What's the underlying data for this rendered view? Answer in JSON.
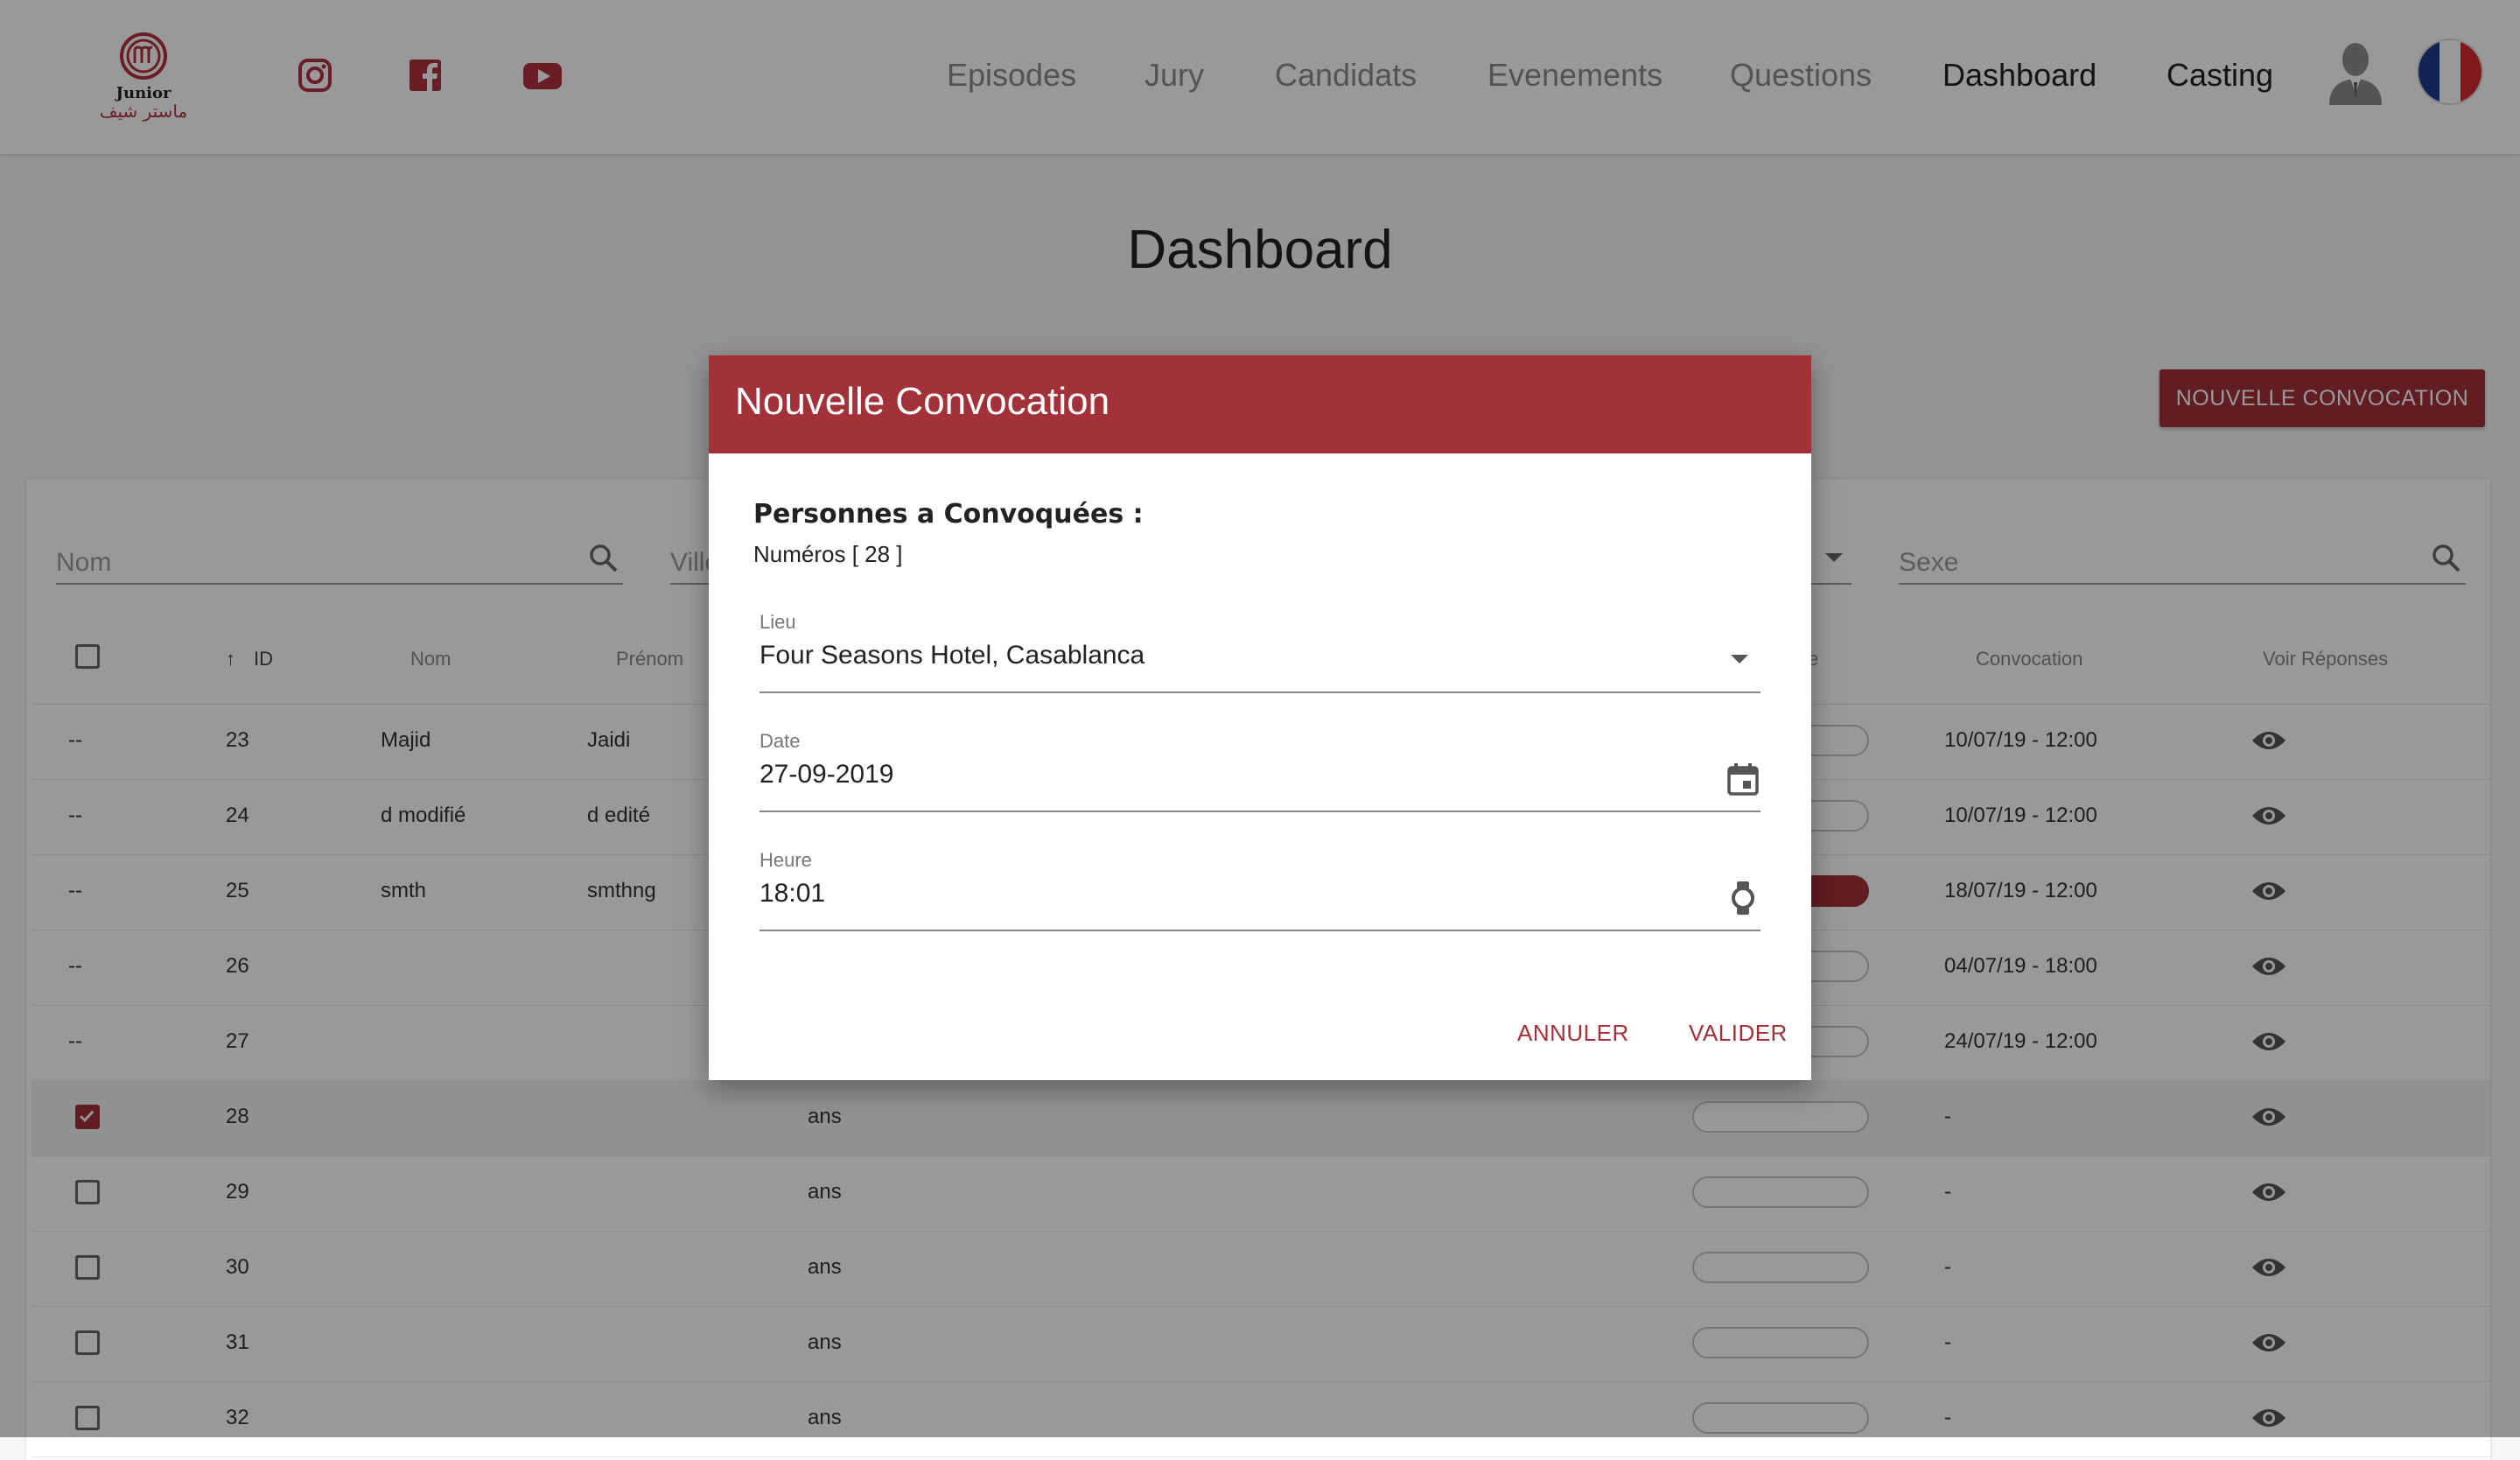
{
  "header": {
    "logo": {
      "line1": "Junior",
      "line2": "ماستر شيف"
    },
    "social": [
      "instagram-icon",
      "facebook-icon",
      "youtube-icon"
    ],
    "nav": [
      "Episodes",
      "Jury",
      "Candidats",
      "Evenements",
      "Questions",
      "Dashboard",
      "Casting"
    ],
    "active_nav": "Dashboard"
  },
  "page": {
    "title": "Dashboard",
    "new_button": "NOUVELLE CONVOCATION"
  },
  "filters": {
    "nom_placeholder": "Nom",
    "ville_placeholder": "Ville",
    "sexe_placeholder": "Sexe"
  },
  "table": {
    "headers": {
      "id": "ID",
      "nom": "Nom",
      "prenom": "Prénom",
      "partial": "e",
      "convocation": "Convocation",
      "voir": "Voir Réponses"
    },
    "rows": [
      {
        "check": "--",
        "id": "23",
        "nom": "Majid",
        "prenom": "Jaidi",
        "age": "",
        "convocation": "10/07/19 - 12:00",
        "toggle": false,
        "checked": false
      },
      {
        "check": "--",
        "id": "24",
        "nom": "d modifié",
        "prenom": "d edité",
        "age": "",
        "convocation": "10/07/19 - 12:00",
        "toggle": false,
        "checked": false
      },
      {
        "check": "--",
        "id": "25",
        "nom": "smth",
        "prenom": "smthng",
        "age": "",
        "convocation": "18/07/19 - 12:00",
        "toggle": true,
        "checked": false
      },
      {
        "check": "--",
        "id": "26",
        "nom": "",
        "prenom": "",
        "age": "",
        "convocation": "04/07/19 - 18:00",
        "toggle": false,
        "checked": false
      },
      {
        "check": "--",
        "id": "27",
        "nom": "",
        "prenom": "",
        "age": "",
        "convocation": "24/07/19 - 12:00",
        "toggle": false,
        "checked": false
      },
      {
        "check": "box",
        "id": "28",
        "nom": "",
        "prenom": "",
        "age": "ans",
        "convocation": "-",
        "toggle": false,
        "checked": true
      },
      {
        "check": "box",
        "id": "29",
        "nom": "",
        "prenom": "",
        "age": "ans",
        "convocation": "-",
        "toggle": false,
        "checked": false
      },
      {
        "check": "box",
        "id": "30",
        "nom": "",
        "prenom": "",
        "age": "ans",
        "convocation": "-",
        "toggle": false,
        "checked": false
      },
      {
        "check": "box",
        "id": "31",
        "nom": "",
        "prenom": "",
        "age": "ans",
        "convocation": "-",
        "toggle": false,
        "checked": false
      },
      {
        "check": "box",
        "id": "32",
        "nom": "",
        "prenom": "",
        "age": "ans",
        "convocation": "-",
        "toggle": false,
        "checked": false
      }
    ]
  },
  "dialog": {
    "title": "Nouvelle Convocation",
    "persons_label": "Personnes a Convoquées :",
    "numbers": "Numéros [ 28 ]",
    "lieu_label": "Lieu",
    "lieu_value": "Four Seasons Hotel, Casablanca",
    "date_label": "Date",
    "date_value": "27-09-2019",
    "heure_label": "Heure",
    "heure_value": "18:01",
    "cancel": "ANNULER",
    "submit": "VALIDER"
  },
  "colors": {
    "brand": "#a23139",
    "overlay": "rgba(0,0,0,0.4)"
  }
}
